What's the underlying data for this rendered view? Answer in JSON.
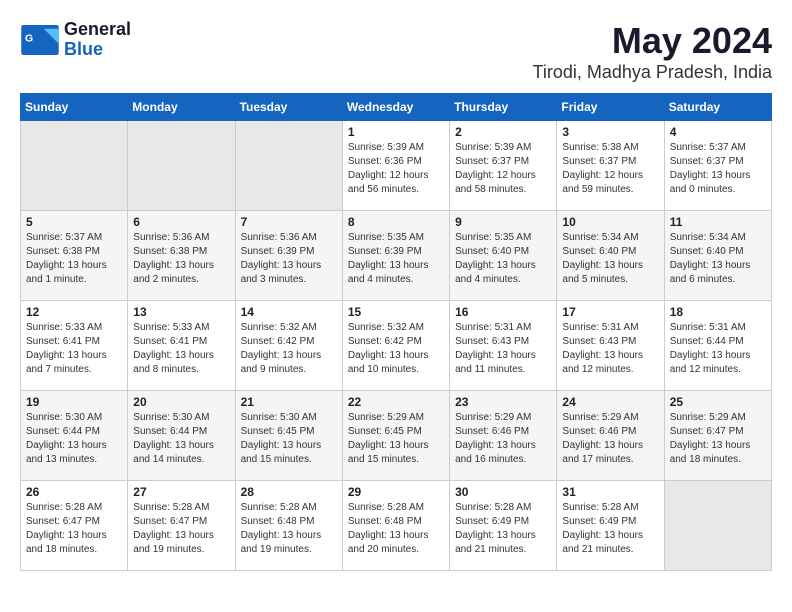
{
  "header": {
    "logo_line1": "General",
    "logo_line2": "Blue",
    "title": "May 2024",
    "subtitle": "Tirodi, Madhya Pradesh, India"
  },
  "days_of_week": [
    "Sunday",
    "Monday",
    "Tuesday",
    "Wednesday",
    "Thursday",
    "Friday",
    "Saturday"
  ],
  "weeks": [
    [
      {
        "num": "",
        "info": ""
      },
      {
        "num": "",
        "info": ""
      },
      {
        "num": "",
        "info": ""
      },
      {
        "num": "1",
        "info": "Sunrise: 5:39 AM\nSunset: 6:36 PM\nDaylight: 12 hours\nand 56 minutes."
      },
      {
        "num": "2",
        "info": "Sunrise: 5:39 AM\nSunset: 6:37 PM\nDaylight: 12 hours\nand 58 minutes."
      },
      {
        "num": "3",
        "info": "Sunrise: 5:38 AM\nSunset: 6:37 PM\nDaylight: 12 hours\nand 59 minutes."
      },
      {
        "num": "4",
        "info": "Sunrise: 5:37 AM\nSunset: 6:37 PM\nDaylight: 13 hours\nand 0 minutes."
      }
    ],
    [
      {
        "num": "5",
        "info": "Sunrise: 5:37 AM\nSunset: 6:38 PM\nDaylight: 13 hours\nand 1 minute."
      },
      {
        "num": "6",
        "info": "Sunrise: 5:36 AM\nSunset: 6:38 PM\nDaylight: 13 hours\nand 2 minutes."
      },
      {
        "num": "7",
        "info": "Sunrise: 5:36 AM\nSunset: 6:39 PM\nDaylight: 13 hours\nand 3 minutes."
      },
      {
        "num": "8",
        "info": "Sunrise: 5:35 AM\nSunset: 6:39 PM\nDaylight: 13 hours\nand 4 minutes."
      },
      {
        "num": "9",
        "info": "Sunrise: 5:35 AM\nSunset: 6:40 PM\nDaylight: 13 hours\nand 4 minutes."
      },
      {
        "num": "10",
        "info": "Sunrise: 5:34 AM\nSunset: 6:40 PM\nDaylight: 13 hours\nand 5 minutes."
      },
      {
        "num": "11",
        "info": "Sunrise: 5:34 AM\nSunset: 6:40 PM\nDaylight: 13 hours\nand 6 minutes."
      }
    ],
    [
      {
        "num": "12",
        "info": "Sunrise: 5:33 AM\nSunset: 6:41 PM\nDaylight: 13 hours\nand 7 minutes."
      },
      {
        "num": "13",
        "info": "Sunrise: 5:33 AM\nSunset: 6:41 PM\nDaylight: 13 hours\nand 8 minutes."
      },
      {
        "num": "14",
        "info": "Sunrise: 5:32 AM\nSunset: 6:42 PM\nDaylight: 13 hours\nand 9 minutes."
      },
      {
        "num": "15",
        "info": "Sunrise: 5:32 AM\nSunset: 6:42 PM\nDaylight: 13 hours\nand 10 minutes."
      },
      {
        "num": "16",
        "info": "Sunrise: 5:31 AM\nSunset: 6:43 PM\nDaylight: 13 hours\nand 11 minutes."
      },
      {
        "num": "17",
        "info": "Sunrise: 5:31 AM\nSunset: 6:43 PM\nDaylight: 13 hours\nand 12 minutes."
      },
      {
        "num": "18",
        "info": "Sunrise: 5:31 AM\nSunset: 6:44 PM\nDaylight: 13 hours\nand 12 minutes."
      }
    ],
    [
      {
        "num": "19",
        "info": "Sunrise: 5:30 AM\nSunset: 6:44 PM\nDaylight: 13 hours\nand 13 minutes."
      },
      {
        "num": "20",
        "info": "Sunrise: 5:30 AM\nSunset: 6:44 PM\nDaylight: 13 hours\nand 14 minutes."
      },
      {
        "num": "21",
        "info": "Sunrise: 5:30 AM\nSunset: 6:45 PM\nDaylight: 13 hours\nand 15 minutes."
      },
      {
        "num": "22",
        "info": "Sunrise: 5:29 AM\nSunset: 6:45 PM\nDaylight: 13 hours\nand 15 minutes."
      },
      {
        "num": "23",
        "info": "Sunrise: 5:29 AM\nSunset: 6:46 PM\nDaylight: 13 hours\nand 16 minutes."
      },
      {
        "num": "24",
        "info": "Sunrise: 5:29 AM\nSunset: 6:46 PM\nDaylight: 13 hours\nand 17 minutes."
      },
      {
        "num": "25",
        "info": "Sunrise: 5:29 AM\nSunset: 6:47 PM\nDaylight: 13 hours\nand 18 minutes."
      }
    ],
    [
      {
        "num": "26",
        "info": "Sunrise: 5:28 AM\nSunset: 6:47 PM\nDaylight: 13 hours\nand 18 minutes."
      },
      {
        "num": "27",
        "info": "Sunrise: 5:28 AM\nSunset: 6:47 PM\nDaylight: 13 hours\nand 19 minutes."
      },
      {
        "num": "28",
        "info": "Sunrise: 5:28 AM\nSunset: 6:48 PM\nDaylight: 13 hours\nand 19 minutes."
      },
      {
        "num": "29",
        "info": "Sunrise: 5:28 AM\nSunset: 6:48 PM\nDaylight: 13 hours\nand 20 minutes."
      },
      {
        "num": "30",
        "info": "Sunrise: 5:28 AM\nSunset: 6:49 PM\nDaylight: 13 hours\nand 21 minutes."
      },
      {
        "num": "31",
        "info": "Sunrise: 5:28 AM\nSunset: 6:49 PM\nDaylight: 13 hours\nand 21 minutes."
      },
      {
        "num": "",
        "info": ""
      }
    ]
  ]
}
